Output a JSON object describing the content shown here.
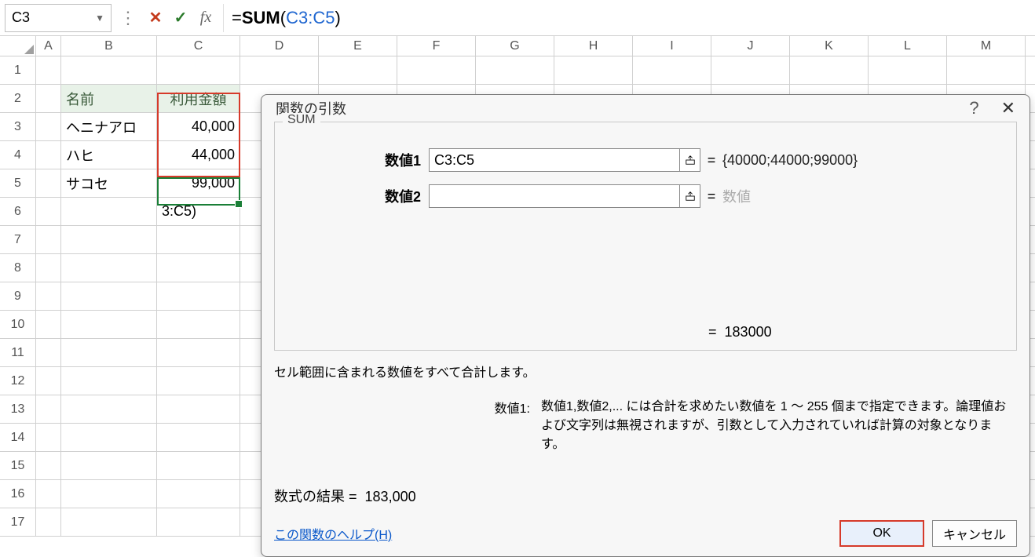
{
  "nameBox": "C3",
  "formula": {
    "eq": "=",
    "fn": "SUM",
    "open": "(",
    "ref": "C3:C5",
    "close": ")"
  },
  "columns": [
    "A",
    "B",
    "C",
    "D",
    "E",
    "F",
    "G",
    "H",
    "I",
    "J",
    "K",
    "L",
    "M"
  ],
  "rowCount": 17,
  "headers": {
    "b2": "名前",
    "c2": "利用金額"
  },
  "data": {
    "b3": "ヘニナアロ",
    "c3": "40,000",
    "b4": "ハヒ",
    "c4": "44,000",
    "b5": "サコセ",
    "c5": "99,000",
    "c6": "3:C5)"
  },
  "dialog": {
    "title": "関数の引数",
    "fnName": "SUM",
    "args": [
      {
        "label": "数値1",
        "value": "C3:C5",
        "result": "{40000;44000;99000}"
      },
      {
        "label": "数値2",
        "value": "",
        "result": "数値",
        "placeholder": true
      }
    ],
    "fnResultEq": "=",
    "fnResult": "183000",
    "desc1": "セル範囲に含まれる数値をすべて合計します。",
    "desc2Label": "数値1:",
    "desc2Text": "数値1,数値2,... には合計を求めたい数値を 1 ～ 255 個まで指定できます。論理値および文字列は無視されますが、引数として入力されていれば計算の対象となります。",
    "resultLabel": "数式の結果 =",
    "resultValue": "183,000",
    "helpLink": "この関数のヘルプ(H)",
    "ok": "OK",
    "cancel": "キャンセル"
  },
  "chart_data": null
}
